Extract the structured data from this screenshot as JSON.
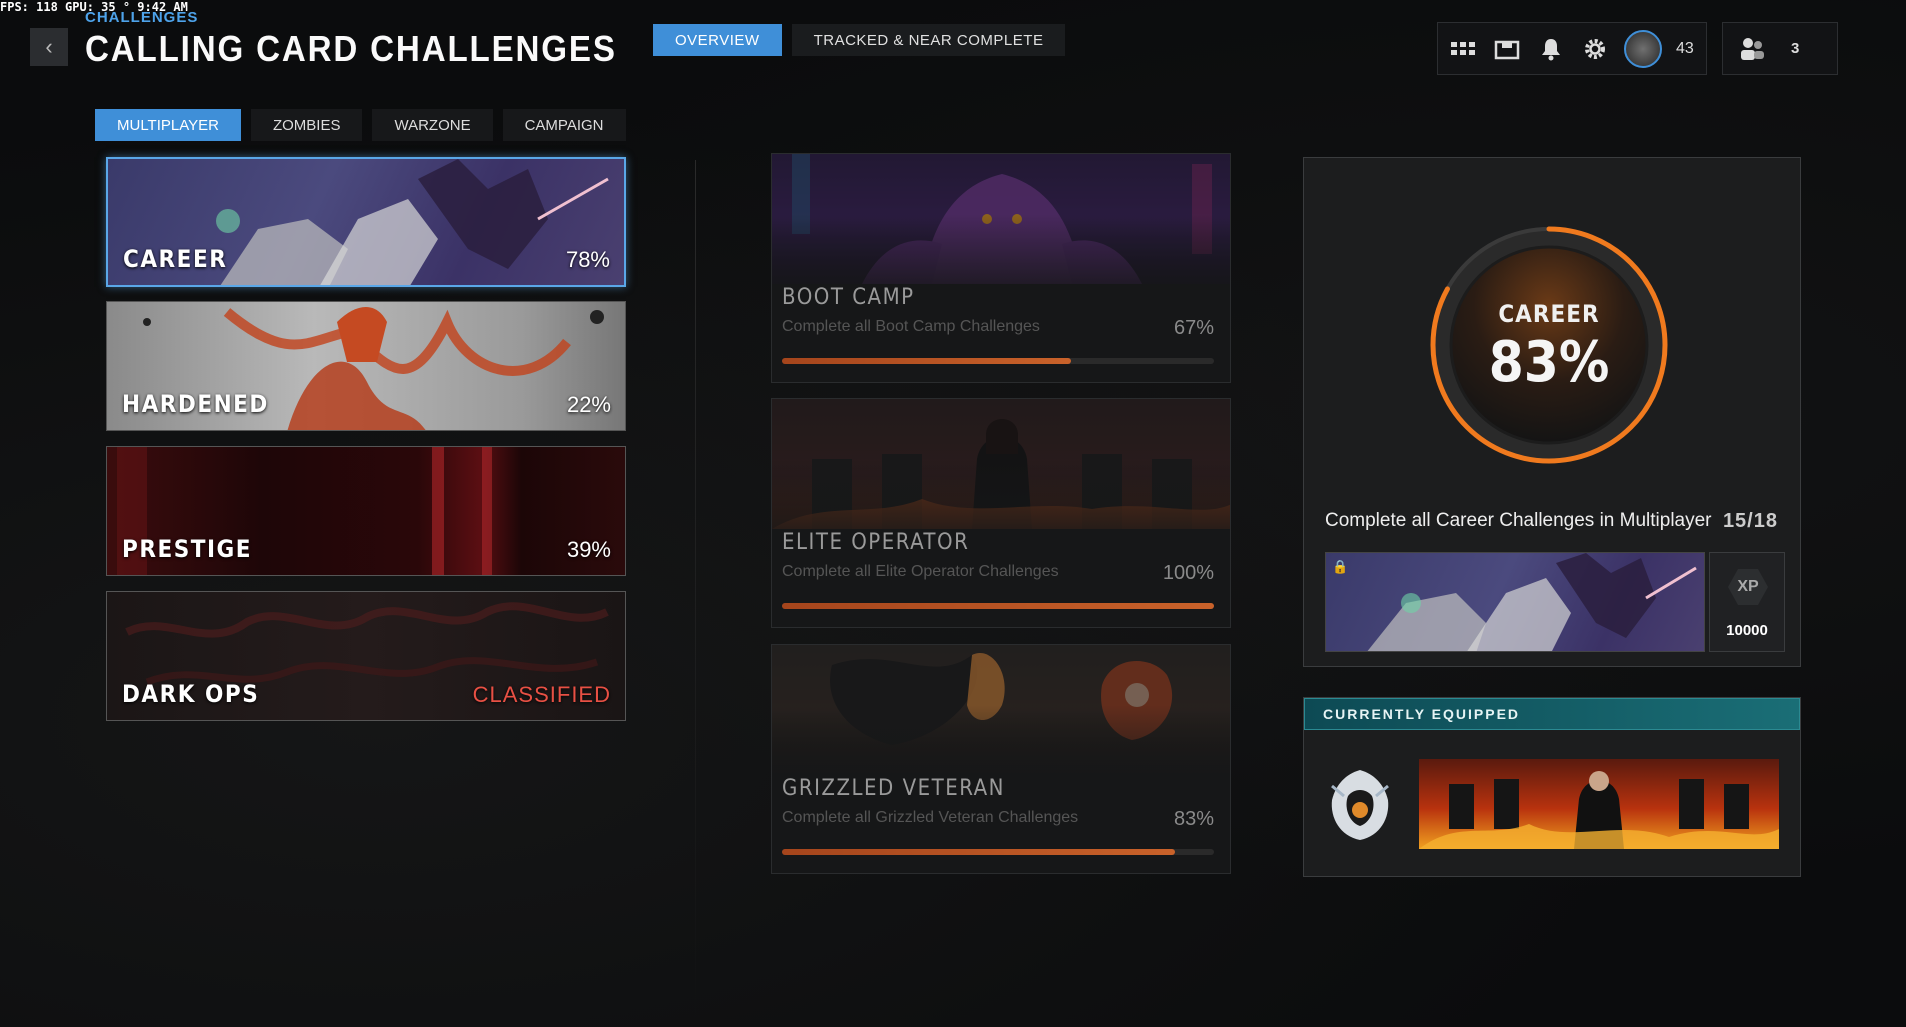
{
  "overlay": {
    "fps": "FPS: 118  GPU: 35 °  9:42 AM"
  },
  "header": {
    "breadcrumb": "CHALLENGES",
    "title": "CALLING CARD CHALLENGES",
    "back_icon": "chevron-left-icon"
  },
  "top_tabs": [
    {
      "label": "OVERVIEW",
      "active": true
    },
    {
      "label": "TRACKED & NEAR COMPLETE",
      "active": false
    }
  ],
  "hud": {
    "icons": [
      "grid-icon",
      "store-icon",
      "bell-icon",
      "gear-icon"
    ],
    "level": "43",
    "friends_count": "3",
    "accent": "#3f8fd8"
  },
  "sub_tabs": [
    {
      "label": "MULTIPLAYER",
      "active": true
    },
    {
      "label": "ZOMBIES",
      "active": false
    },
    {
      "label": "WARZONE",
      "active": false
    },
    {
      "label": "CAMPAIGN",
      "active": false
    }
  ],
  "categories": [
    {
      "name": "CAREER",
      "percent": "78%",
      "selected": true
    },
    {
      "name": "HARDENED",
      "percent": "22%",
      "selected": false
    },
    {
      "name": "PRESTIGE",
      "percent": "39%",
      "selected": false
    },
    {
      "name": "DARK OPS",
      "percent": "CLASSIFIED",
      "selected": false
    }
  ],
  "challenges": [
    {
      "title": "BOOT CAMP",
      "description": "Complete all Boot Camp Challenges",
      "percent": "67%",
      "progress": 0.67
    },
    {
      "title": "ELITE OPERATOR",
      "description": "Complete all Elite Operator Challenges",
      "percent": "100%",
      "progress": 1.0
    },
    {
      "title": "GRIZZLED VETERAN",
      "description": "Complete all Grizzled Veteran Challenges",
      "percent": "83%",
      "progress": 0.91
    }
  ],
  "detail": {
    "ring_label": "CAREER",
    "ring_percent": "83%",
    "ring_progress": 0.83,
    "goal": "Complete all Career Challenges in Multiplayer",
    "progress": "15/18",
    "reward_xp_label": "XP",
    "reward_xp": "10000",
    "accent": "#f07a1e"
  },
  "equipped": {
    "header": "CURRENTLY EQUIPPED"
  }
}
